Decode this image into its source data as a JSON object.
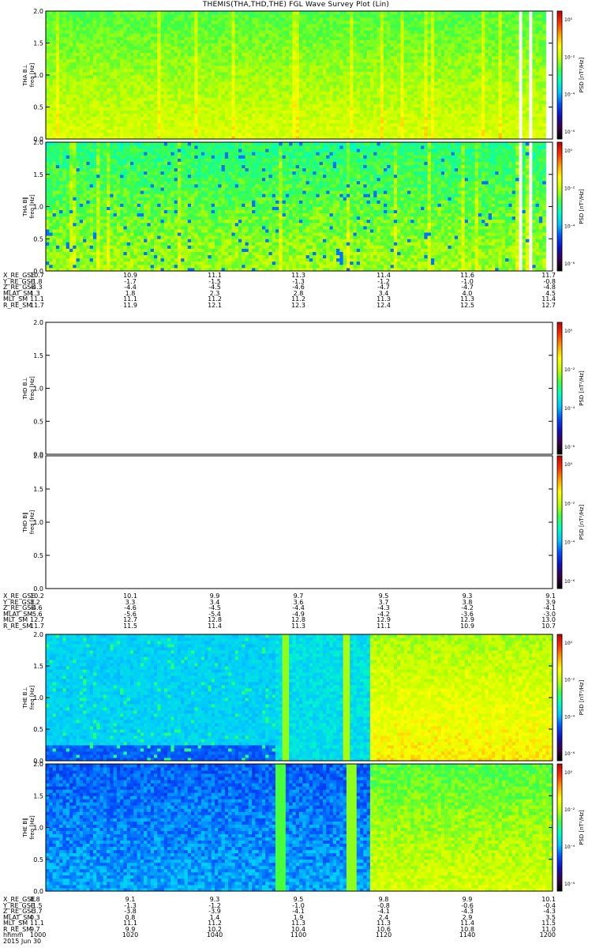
{
  "title": "THEMIS(THA,THD,THE) FGL Wave Survey Plot (Lin)",
  "colors": {
    "colorbar_stops": [
      "#000000",
      "#3a004a",
      "#1010c0",
      "#0050ff",
      "#00c8ff",
      "#00ffc0",
      "#40ff40",
      "#c0ff00",
      "#ffff00",
      "#ffa000",
      "#ff3000",
      "#c00000"
    ]
  },
  "panels": [
    {
      "id": "tha-bperp",
      "probe": "THA",
      "ylabel_top": "THA B⊥",
      "ylabel": "freq [Hz]",
      "cblabel": "PSD [nT²/Hz]",
      "yticks": [
        "0.0",
        "0.5",
        "1.0",
        "1.5",
        "2.0"
      ],
      "cbticks": [
        "10⁰",
        "10⁻²",
        "10⁻⁴",
        "10⁻⁶"
      ],
      "has_data": true,
      "style": "tha"
    },
    {
      "id": "tha-bpar",
      "probe": "THA",
      "ylabel_top": "THA B∥",
      "ylabel": "freq [Hz]",
      "cblabel": "PSD [nT²/Hz]",
      "yticks": [
        "0.0",
        "0.5",
        "1.0",
        "1.5",
        "2.0"
      ],
      "cbticks": [
        "10⁰",
        "10⁻²",
        "10⁻⁴",
        "10⁻⁶"
      ],
      "has_data": true,
      "style": "tha2"
    },
    {
      "id": "thd-bperp",
      "probe": "THD",
      "ylabel_top": "THD B⊥",
      "ylabel": "freq [Hz]",
      "cblabel": "PSD [nT²/Hz]",
      "yticks": [
        "0.0",
        "0.5",
        "1.0",
        "1.5",
        "2.0"
      ],
      "cbticks": [
        "10⁰",
        "10⁻²",
        "10⁻⁴",
        "10⁻⁶"
      ],
      "has_data": false,
      "style": "none"
    },
    {
      "id": "thd-bpar",
      "probe": "THD",
      "ylabel_top": "THD B∥",
      "ylabel": "freq [Hz]",
      "cblabel": "PSD [nT²/Hz]",
      "yticks": [
        "0.0",
        "0.5",
        "1.0",
        "1.5",
        "2.0"
      ],
      "cbticks": [
        "10⁰",
        "10⁻²",
        "10⁻⁴",
        "10⁻⁶"
      ],
      "has_data": false,
      "style": "none"
    },
    {
      "id": "the-bperp",
      "probe": "THE",
      "ylabel_top": "THE B⊥",
      "ylabel": "freq [Hz]",
      "cblabel": "PSD [nT²/Hz]",
      "yticks": [
        "0.0",
        "0.5",
        "1.0",
        "1.5",
        "2.0"
      ],
      "cbticks": [
        "10⁰",
        "10⁻²",
        "10⁻⁴",
        "10⁻⁶"
      ],
      "has_data": true,
      "style": "the"
    },
    {
      "id": "the-bpar",
      "probe": "THE",
      "ylabel_top": "THE B∥",
      "ylabel": "freq [Hz]",
      "cblabel": "PSD [nT²/Hz]",
      "yticks": [
        "0.0",
        "0.5",
        "1.0",
        "1.5",
        "2.0"
      ],
      "cbticks": [
        "10⁰",
        "10⁻²",
        "10⁻⁴",
        "10⁻⁶"
      ],
      "has_data": true,
      "style": "the2"
    }
  ],
  "ephemeris": [
    {
      "labels": [
        "X_RE_GSE",
        "Y_RE_GSE",
        "Z_RE_GSE",
        "MLAT_SM",
        "MLT_SM",
        "R_RE_SM"
      ],
      "columns": [
        [
          "10.7",
          "-1.8",
          "-4.3",
          "1.3",
          "11.1",
          "11.7"
        ],
        [
          "10.9",
          "-1.7",
          "-4.4",
          "1.8",
          "11.1",
          "11.9"
        ],
        [
          "11.1",
          "-1.5",
          "-4.5",
          "2.3",
          "11.2",
          "12.1"
        ],
        [
          "11.3",
          "-1.3",
          "-4.6",
          "2.8",
          "11.2",
          "12.3"
        ],
        [
          "11.4",
          "-1.2",
          "-4.7",
          "3.4",
          "11.3",
          "12.4"
        ],
        [
          "11.6",
          "-1.0",
          "-4.7",
          "4.0",
          "11.3",
          "12.5"
        ],
        [
          "11.7",
          "-0.8",
          "-4.8",
          "4.5",
          "11.4",
          "12.7"
        ]
      ]
    },
    {
      "labels": [
        "X_RE_GSE",
        "Y_RE_GSE",
        "Z_RE_GSE",
        "MLAT_SM",
        "MLT_SM",
        "R_RE_SM"
      ],
      "columns": [
        [
          "10.2",
          "3.2",
          "-4.6",
          "-5.6",
          "12.7",
          "11.7"
        ],
        [
          "10.1",
          "3.3",
          "-4.6",
          "-5.6",
          "12.7",
          "11.5"
        ],
        [
          "9.9",
          "3.4",
          "-4.5",
          "-5.4",
          "12.8",
          "11.4"
        ],
        [
          "9.7",
          "3.6",
          "-4.4",
          "-4.9",
          "12.8",
          "11.3"
        ],
        [
          "9.5",
          "3.7",
          "-4.3",
          "-4.2",
          "12.9",
          "11.1"
        ],
        [
          "9.3",
          "3.8",
          "-4.2",
          "-3.6",
          "12.9",
          "10.9"
        ],
        [
          "9.1",
          "3.9",
          "-4.1",
          "-3.0",
          "13.0",
          "10.7"
        ]
      ]
    },
    {
      "labels": [
        "X_RE_GSE",
        "Y_RE_GSE",
        "Z_RE_GSE",
        "MLAT_SM",
        "MLT_SM",
        "R_RE_SM",
        "hhmm",
        "2015 Jun 30"
      ],
      "columns": [
        [
          "8.8",
          "-1.5",
          "-3.7",
          "0.3",
          "11.1",
          "9.7",
          "1000"
        ],
        [
          "9.1",
          "-1.3",
          "-3.8",
          "0.8",
          "11.1",
          "9.9",
          "1020"
        ],
        [
          "9.3",
          "-1.2",
          "-3.9",
          "1.4",
          "11.2",
          "10.2",
          "1040"
        ],
        [
          "9.5",
          "-1.0",
          "-4.1",
          "1.9",
          "11.3",
          "10.4",
          "1100"
        ],
        [
          "9.8",
          "-0.8",
          "-4.1",
          "2.4",
          "11.3",
          "10.6",
          "1120"
        ],
        [
          "9.9",
          "-0.6",
          "-4.3",
          "2.9",
          "11.4",
          "10.8",
          "1140"
        ],
        [
          "10.1",
          "-0.4",
          "-4.3",
          "3.5",
          "11.5",
          "11.0",
          "1200"
        ]
      ]
    }
  ],
  "chart_data": [
    {
      "type": "heatmap",
      "title": "THEMIS(THA,THD,THE) FGL Wave Survey Plot (Lin)",
      "ylabel": "freq [Hz]",
      "series": [
        {
          "name": "THA B⊥"
        }
      ],
      "ylim": [
        0,
        2
      ],
      "colorbar": "PSD [nT²/Hz]",
      "colorbar_range": [
        "10⁻⁶",
        "10⁰"
      ],
      "x": [
        "1000",
        "1020",
        "1040",
        "1100",
        "1120",
        "1140",
        "1200"
      ]
    },
    {
      "type": "heatmap",
      "ylabel": "freq [Hz]",
      "series": [
        {
          "name": "THA B∥"
        }
      ],
      "ylim": [
        0,
        2
      ],
      "colorbar": "PSD [nT²/Hz]"
    },
    {
      "type": "heatmap",
      "ylabel": "freq [Hz]",
      "series": [
        {
          "name": "THD B⊥"
        }
      ],
      "ylim": [
        0,
        2
      ],
      "colorbar": "PSD [nT²/Hz]"
    },
    {
      "type": "heatmap",
      "ylabel": "freq [Hz]",
      "series": [
        {
          "name": "THD B∥"
        }
      ],
      "ylim": [
        0,
        2
      ],
      "colorbar": "PSD [nT²/Hz]"
    },
    {
      "type": "heatmap",
      "ylabel": "freq [Hz]",
      "series": [
        {
          "name": "THE B⊥"
        }
      ],
      "ylim": [
        0,
        2
      ],
      "colorbar": "PSD [nT²/Hz]"
    },
    {
      "type": "heatmap",
      "ylabel": "freq [Hz]",
      "series": [
        {
          "name": "THE B∥"
        }
      ],
      "ylim": [
        0,
        2
      ],
      "colorbar": "PSD [nT²/Hz]"
    }
  ]
}
